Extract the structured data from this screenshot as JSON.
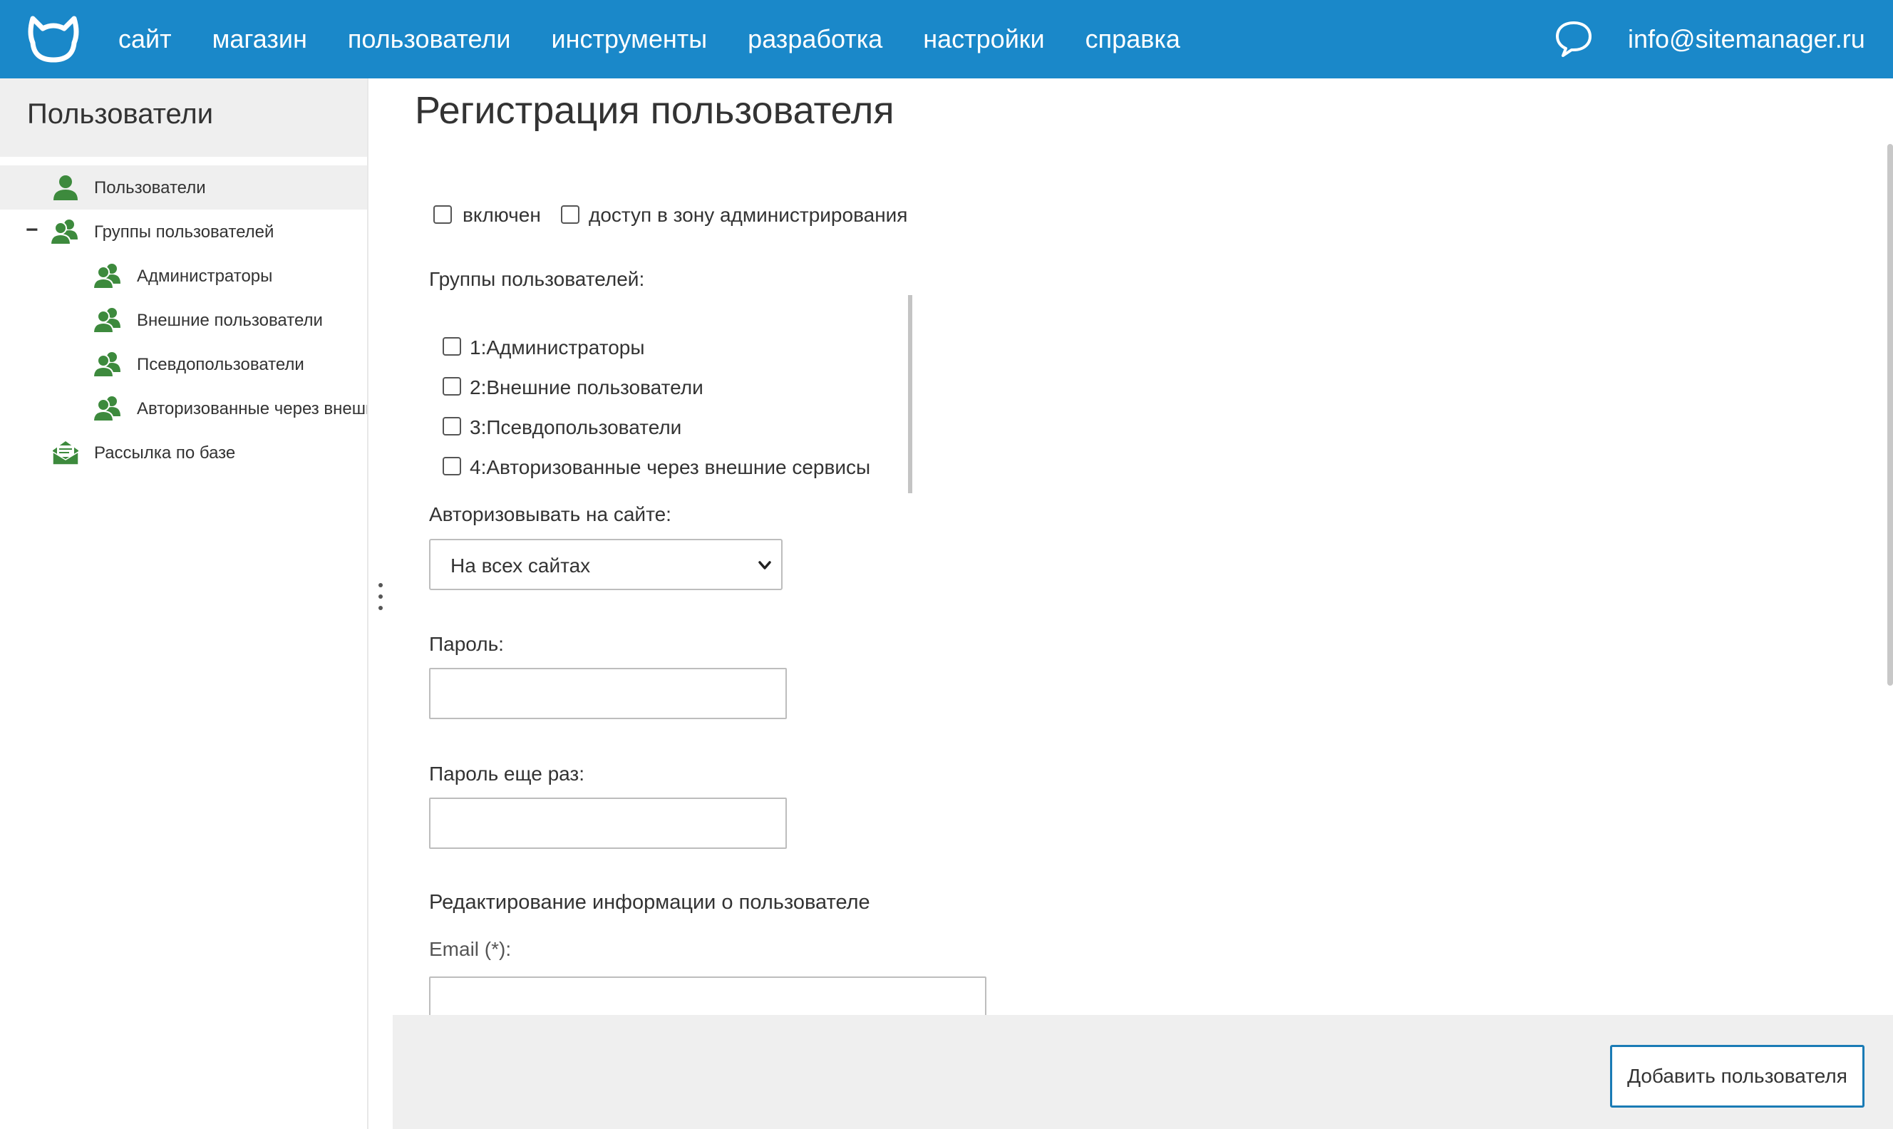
{
  "nav": {
    "items": [
      "сайт",
      "магазин",
      "пользователи",
      "инструменты",
      "разработка",
      "настройки",
      "справка"
    ],
    "email": "info@sitemanager.ru"
  },
  "sidebar": {
    "title": "Пользователи",
    "items": [
      {
        "label": "Пользователи"
      },
      {
        "label": "Группы пользователей"
      },
      {
        "label": "Администраторы"
      },
      {
        "label": "Внешние пользователи"
      },
      {
        "label": "Псевдопользователи"
      },
      {
        "label": "Авторизованные через внешние сервисы"
      },
      {
        "label": "Рассылка по базе"
      }
    ]
  },
  "form": {
    "title": "Регистрация пользователя",
    "enabled_label": "включен",
    "admin_access_label": "доступ в зону администрирования",
    "groups_label": "Группы пользователей:",
    "groups": [
      "1:Администраторы",
      "2:Внешние пользователи",
      "3:Псевдопользователи",
      "4:Авторизованные через внешние сервисы"
    ],
    "site_label": "Авторизовывать на сайте:",
    "site_value": "На всех сайтах",
    "password_label": "Пароль:",
    "password_repeat_label": "Пароль еще раз:",
    "section_title": "Редактирование информации о пользователе",
    "email_label": "Email (*):",
    "submit_label": "Добавить пользователя"
  },
  "colors": {
    "accent": "#1a88c9",
    "icon_green": "#3d8a3d"
  }
}
